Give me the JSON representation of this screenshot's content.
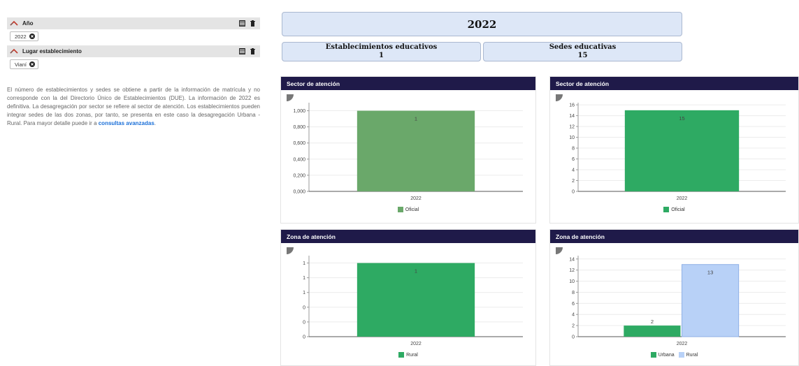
{
  "filters": [
    {
      "label": "Año",
      "value": "2022"
    },
    {
      "label": "Lugar establecimiento",
      "value": "Vianí"
    }
  ],
  "description": {
    "text": "El número de establecimientos y sedes se obtiene a partir de la información de matrícula y no corresponde con la del Directorio Único de Establecimientos (DUE). La información de 2022 es definitiva. La desagregación por sector se refiere al sector de atención. Los establecimientos pueden integrar sedes de las dos zonas, por tanto, se presenta en este caso la desagregación Urbana - Rural. Para mayor detalle puede ir a ",
    "link": "consultas avanzadas",
    "end": "."
  },
  "header": {
    "year": "2022",
    "establecimientos": {
      "label": "Establecimientos educativos",
      "value": "1"
    },
    "sedes": {
      "label": "Sedes educativas",
      "value": "15"
    }
  },
  "colors": {
    "green": "#2eaa63",
    "green_muted": "#6aa86a",
    "light_blue": "#b8d1f7",
    "header_navy": "#1f1a49"
  },
  "chart_data": [
    {
      "type": "bar",
      "title": "Sector de atención",
      "categories": [
        "2022"
      ],
      "series": [
        {
          "name": "Oficial",
          "values": [
            1
          ],
          "color": "#6aa86a"
        }
      ],
      "ylim": [
        0,
        1.1
      ],
      "yticks": [
        0,
        0.2,
        0.4,
        0.6,
        0.8,
        1.0
      ],
      "ytick_labels": [
        "0,000",
        "0,200",
        "0,400",
        "0,600",
        "0,800",
        "1,000"
      ],
      "data_labels": [
        "1"
      ]
    },
    {
      "type": "bar",
      "title": "Sector de atención",
      "categories": [
        "2022"
      ],
      "series": [
        {
          "name": "Oficial",
          "values": [
            15
          ],
          "color": "#2eaa63"
        }
      ],
      "ylim": [
        0,
        16.4
      ],
      "yticks": [
        0,
        2,
        4,
        6,
        8,
        10,
        12,
        14,
        16
      ],
      "ytick_labels": [
        "0",
        "2",
        "4",
        "6",
        "8",
        "10",
        "12",
        "14",
        "16"
      ],
      "data_labels": [
        "15"
      ]
    },
    {
      "type": "bar",
      "title": "Zona de atención",
      "categories": [
        "2022"
      ],
      "series": [
        {
          "name": "Rural",
          "values": [
            1
          ],
          "color": "#2eaa63"
        }
      ],
      "ylim": [
        0,
        1.1
      ],
      "yticks": [
        0,
        0.2,
        0.4,
        0.6,
        0.8,
        1.0
      ],
      "ytick_labels": [
        "0",
        "0",
        "0",
        "1",
        "1",
        "1"
      ],
      "data_labels": [
        "1"
      ]
    },
    {
      "type": "bar",
      "title": "Zona de atención",
      "categories": [
        "2022"
      ],
      "series": [
        {
          "name": "Urbana",
          "values": [
            2
          ],
          "color": "#2eaa63"
        },
        {
          "name": "Rural",
          "values": [
            13
          ],
          "color": "#b8d1f7"
        }
      ],
      "ylim": [
        0,
        14.6
      ],
      "yticks": [
        0,
        2,
        4,
        6,
        8,
        10,
        12,
        14
      ],
      "ytick_labels": [
        "0",
        "2",
        "4",
        "6",
        "8",
        "10",
        "12",
        "14"
      ],
      "data_labels": [
        "2",
        "13"
      ]
    }
  ]
}
